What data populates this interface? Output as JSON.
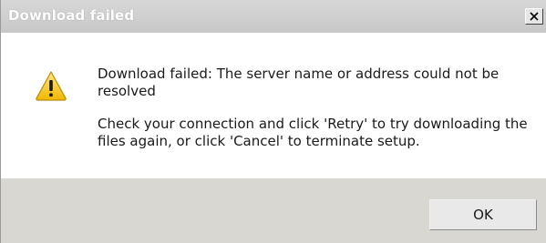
{
  "dialog": {
    "title": "Download failed",
    "close_symbol": "×",
    "icon": "warning-icon",
    "message_line1": "Download failed: The server name or address could not be resolved",
    "message_line2": "Check your connection and click 'Retry' to try downloading the files again, or click 'Cancel' to terminate setup.",
    "ok_label": "OK"
  },
  "colors": {
    "titlebar": "#cfcfcf",
    "footer": "#d9d7d2",
    "warning_yellow": "#f2c418"
  }
}
